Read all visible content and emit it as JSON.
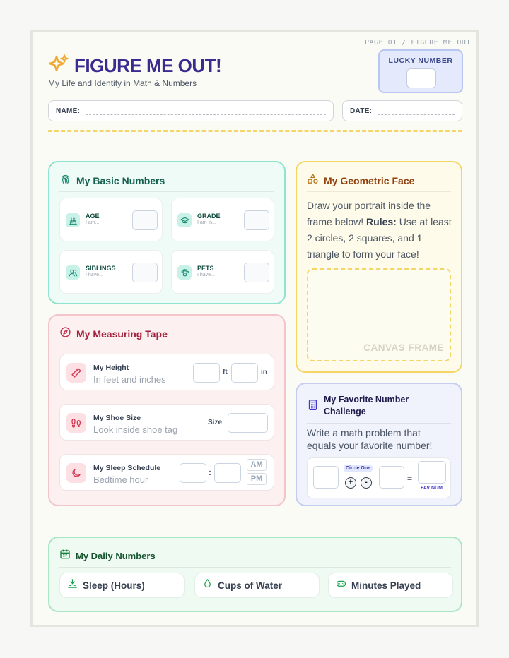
{
  "header": {
    "page_label": "PAGE 01 / FIGURE ME OUT",
    "title": "FIGURE ME OUT!",
    "subtitle": "My Life and Identity in Math & Numbers",
    "lucky_label": "LUCKY NUMBER",
    "name_label": "NAME:",
    "date_label": "DATE:"
  },
  "basic": {
    "title": "My Basic Numbers",
    "items": [
      {
        "label": "AGE",
        "hint": "I am..."
      },
      {
        "label": "GRADE",
        "hint": "I am in..."
      },
      {
        "label": "SIBLINGS",
        "hint": "I have..."
      },
      {
        "label": "PETS",
        "hint": "I have..."
      }
    ]
  },
  "tape": {
    "title": "My Measuring Tape",
    "height": {
      "title": "My Height",
      "sub": "In feet and inches",
      "unit1": "ft",
      "unit2": "in"
    },
    "shoe": {
      "title": "My Shoe Size",
      "sub": "Look inside shoe tag",
      "unit": "Size"
    },
    "sleep": {
      "title": "My Sleep Schedule",
      "sub": "Bedtime hour",
      "colon": ":",
      "am": "AM",
      "pm": "PM"
    }
  },
  "geo": {
    "title": "My Geometric Face",
    "text_a": "Draw your portrait inside the frame below! ",
    "text_rules": "Rules:",
    "text_b": " Use at least 2 circles, 2 squares, and 1 triangle to form your face!",
    "frame_label": "CANVAS FRAME"
  },
  "fav": {
    "title": "My Favorite Number Challenge",
    "text": "Write a math problem that equals your favorite number!",
    "circle_one": "Circle One",
    "plus": "+",
    "minus": "-",
    "equals": "=",
    "fav_num": "FAV NUM"
  },
  "daily": {
    "title": "My Daily Numbers",
    "items": [
      "Sleep (Hours)",
      "Cups of Water",
      "Minutes Played"
    ]
  },
  "colors": {
    "title": "#3b2b8f",
    "teal": "#5ed3b8",
    "red": "#f2b7bd",
    "yellow": "#f5d565",
    "lavender": "#b9c6f2",
    "green": "#a8e6c4"
  }
}
